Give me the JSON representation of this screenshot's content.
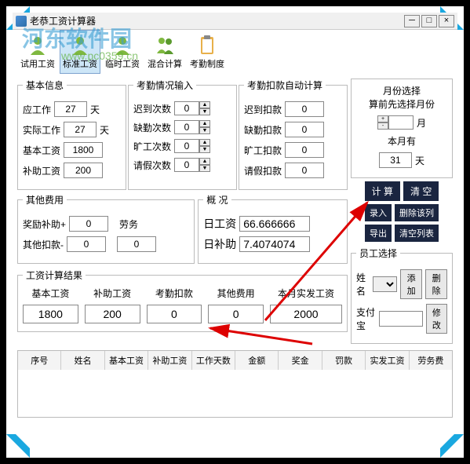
{
  "window": {
    "title": "老恭工资计算器",
    "min": "─",
    "max": "□",
    "close": "×"
  },
  "watermark": {
    "text": "河东软件园",
    "url": "www.pc0359.cn"
  },
  "toolbar": {
    "items": [
      {
        "label": "试用工资"
      },
      {
        "label": "标准工资"
      },
      {
        "label": "临时工资"
      },
      {
        "label": "混合计算"
      },
      {
        "label": "考勤制度"
      }
    ]
  },
  "basic_info": {
    "legend": "基本信息",
    "should_work_label": "应工作",
    "should_work_value": "27",
    "days_unit": "天",
    "actual_work_label": "实际工作",
    "actual_work_value": "27",
    "base_salary_label": "基本工资",
    "base_salary_value": "1800",
    "subsidy_label": "补助工资",
    "subsidy_value": "200"
  },
  "attendance_input": {
    "legend": "考勤情况输入",
    "late_label": "迟到次数",
    "late_value": "0",
    "absent_label": "缺勤次数",
    "absent_value": "0",
    "truancy_label": "旷工次数",
    "truancy_value": "0",
    "leave_label": "请假次数",
    "leave_value": "0"
  },
  "deduction": {
    "legend": "考勤扣款自动计算",
    "late_label": "迟到扣款",
    "late_value": "0",
    "absent_label": "缺勤扣款",
    "absent_value": "0",
    "truancy_label": "旷工扣款",
    "truancy_value": "0",
    "leave_label": "请假扣款",
    "leave_value": "0"
  },
  "other_fees": {
    "legend": "其他费用",
    "bonus_label": "奖励补助+",
    "bonus_value": "0",
    "deduct_label": "其他扣款-",
    "deduct_value": "0",
    "labor_label": "劳务",
    "labor_value": "0"
  },
  "overview": {
    "legend": "概 况",
    "day_salary_label": "日工资",
    "day_salary_value": "66.666666",
    "day_subsidy_label": "日补助",
    "day_subsidy_value": "7.4074074"
  },
  "month_select": {
    "label": "月份选择",
    "hint": "算前先选择月份",
    "month_value": "",
    "month_unit": "月",
    "has_label": "本月有",
    "days_value": "31",
    "days_unit": "天"
  },
  "actions": {
    "calc": "计 算",
    "clear": "清 空",
    "input": "录入",
    "delete_row": "删除该列",
    "export": "导出",
    "clear_list": "清空列表"
  },
  "result": {
    "legend": "工资计算结果",
    "cols": [
      {
        "label": "基本工资",
        "value": "1800"
      },
      {
        "label": "补助工资",
        "value": "200"
      },
      {
        "label": "考勤扣款",
        "value": "0"
      },
      {
        "label": "其他费用",
        "value": "0"
      },
      {
        "label": "本月实发工资",
        "value": "2000"
      }
    ]
  },
  "employee": {
    "legend": "员工选择",
    "name_label": "姓名",
    "name_value": "",
    "add": "添加",
    "delete": "删除",
    "alipay_label": "支付宝",
    "alipay_value": "",
    "modify": "修改"
  },
  "table": {
    "headers": [
      "序号",
      "姓名",
      "基本工资",
      "补助工资",
      "工作天数",
      "金额",
      "奖金",
      "罚款",
      "实发工资",
      "劳务费"
    ]
  }
}
